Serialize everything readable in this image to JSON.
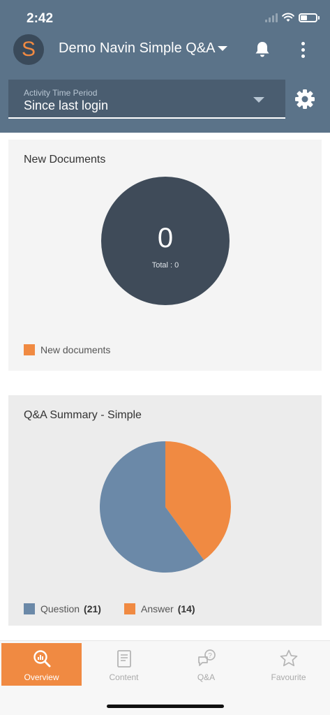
{
  "status": {
    "time": "2:42"
  },
  "header": {
    "logo_letter": "S",
    "title": "Demo Navin Simple Q&A"
  },
  "filter": {
    "label": "Activity Time Period",
    "value": "Since last login"
  },
  "new_documents": {
    "title": "New Documents",
    "count": "0",
    "total_text": "Total : 0",
    "legend_label": "New documents",
    "color": "#f08a42"
  },
  "qa_summary": {
    "title": "Q&A Summary - Simple",
    "legend": [
      {
        "label": "Question",
        "count": "(21)",
        "color": "#6b89a8"
      },
      {
        "label": "Answer",
        "count": "(14)",
        "color": "#f08a42"
      }
    ]
  },
  "chart_data": [
    {
      "type": "pie",
      "categories": [
        "New documents"
      ],
      "values": [
        0
      ],
      "total": 0
    },
    {
      "type": "pie",
      "title": "Q&A Summary - Simple",
      "categories": [
        "Question",
        "Answer"
      ],
      "values": [
        21,
        14
      ],
      "colors": [
        "#6b89a8",
        "#f08a42"
      ]
    }
  ],
  "nav": {
    "items": [
      {
        "label": "Overview",
        "icon": "overview-icon",
        "active": true
      },
      {
        "label": "Content",
        "icon": "content-icon",
        "active": false
      },
      {
        "label": "Q&A",
        "icon": "qa-icon",
        "active": false
      },
      {
        "label": "Favourite",
        "icon": "star-icon",
        "active": false
      }
    ]
  },
  "colors": {
    "header": "#5b7389",
    "accent": "#f08a42",
    "donut": "#3f4b59"
  }
}
